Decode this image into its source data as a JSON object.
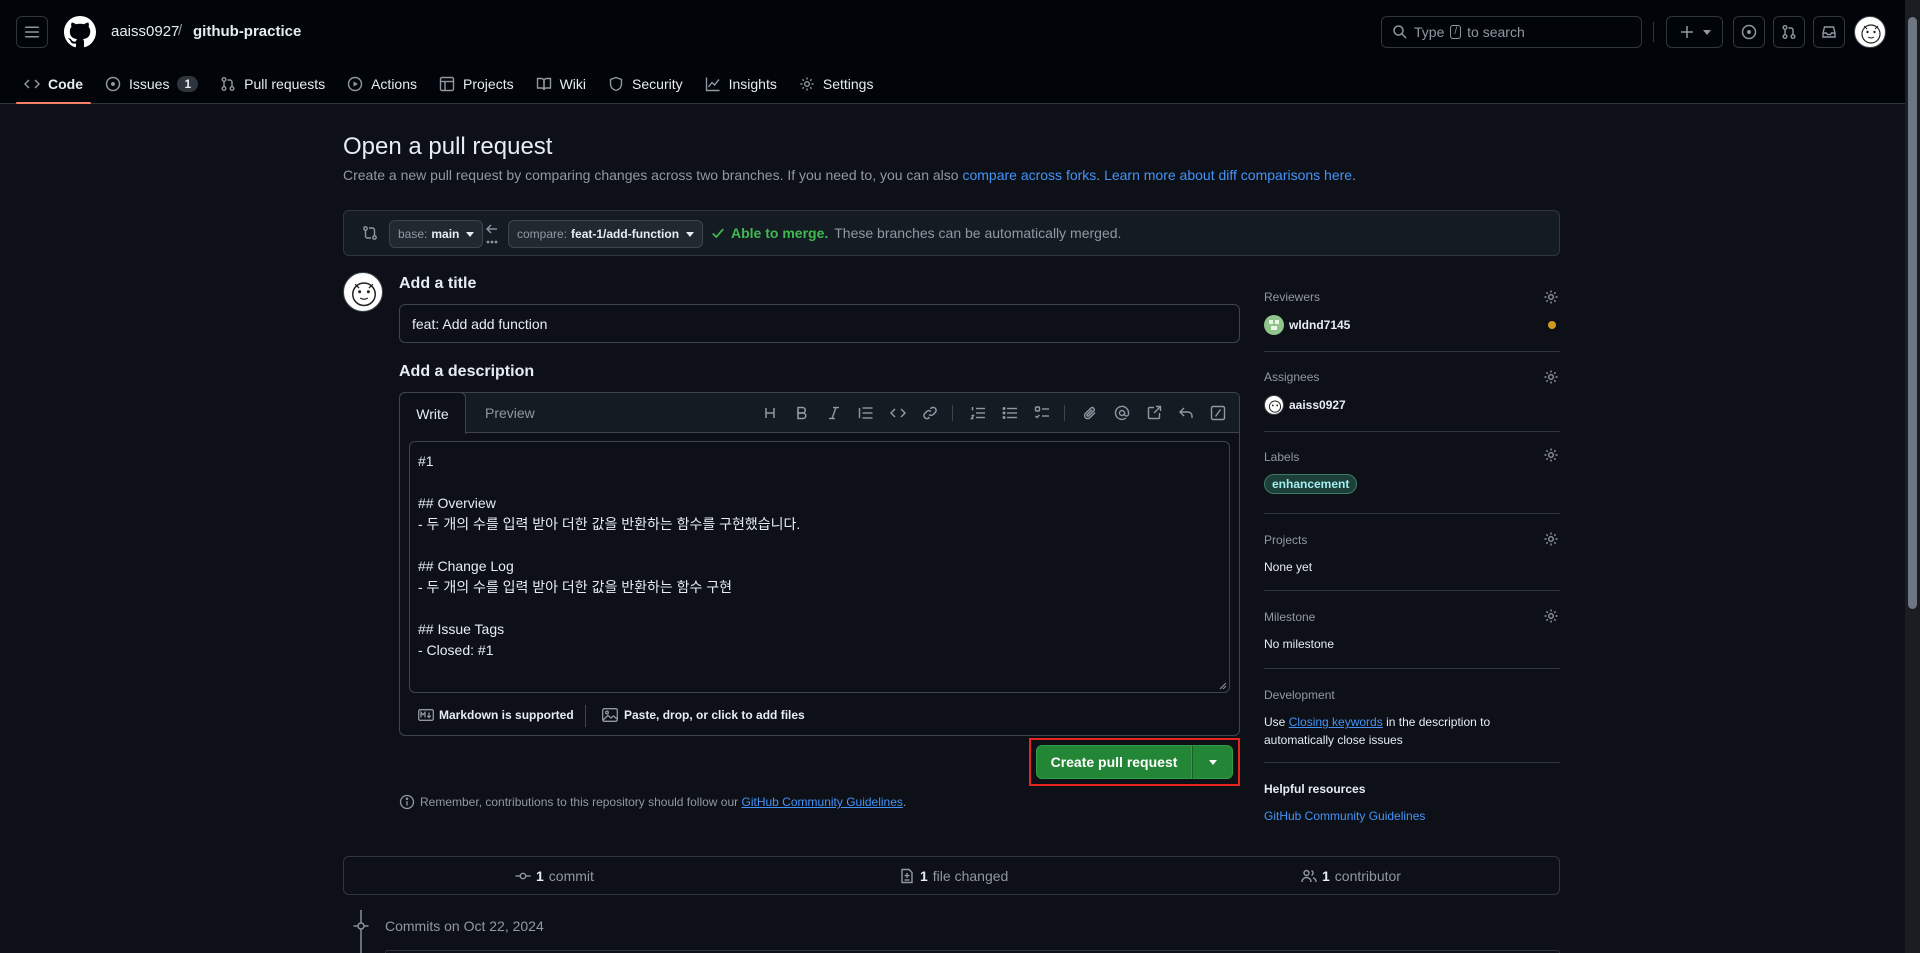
{
  "header": {
    "repo_owner": "aaiss0927",
    "repo_sep": "/",
    "repo_name": "github-practice",
    "search_type": "Type",
    "search_key": "/",
    "search_rest": "to search"
  },
  "tabs": [
    {
      "label": "Code",
      "icon": "code-icon"
    },
    {
      "label": "Issues",
      "icon": "issue-icon",
      "count": "1"
    },
    {
      "label": "Pull requests",
      "icon": "pull-request-icon"
    },
    {
      "label": "Actions",
      "icon": "play-icon"
    },
    {
      "label": "Projects",
      "icon": "table-icon"
    },
    {
      "label": "Wiki",
      "icon": "book-icon"
    },
    {
      "label": "Security",
      "icon": "shield-icon"
    },
    {
      "label": "Insights",
      "icon": "graph-icon"
    },
    {
      "label": "Settings",
      "icon": "gear-icon"
    }
  ],
  "main": {
    "title": "Open a pull request",
    "subtitle_prefix": "Create a new pull request by comparing changes across two branches. If you need to, you can also ",
    "subtitle_link1": "compare across forks",
    "subtitle_mid": ". ",
    "subtitle_link2": "Learn more about diff comparisons here",
    "subtitle_end": "."
  },
  "compare": {
    "base_prefix": "base:",
    "base_branch": "main",
    "compare_prefix": "compare:",
    "compare_branch": "feat-1/add-function",
    "merge_status": "Able to merge.",
    "merge_detail": "These branches can be automatically merged."
  },
  "form": {
    "title_heading": "Add a title",
    "title_value": "feat: Add add function",
    "desc_heading": "Add a description",
    "tab_write": "Write",
    "tab_preview": "Preview",
    "body_lines": [
      "#1",
      "",
      "## Overview",
      "- 두 개의 수를 입력 받아 더한 값을 반환하는 함수를 구현했습니다.",
      "",
      "## Change Log",
      "- 두 개의 수를 입력 받아 더한 값을 반환하는 함수 구현",
      "",
      "## Issue Tags",
      "- Closed: #1"
    ],
    "markdown_note": "Markdown is supported",
    "attach_note": "Paste, drop, or click to add files",
    "create_label": "Create pull request",
    "remember_prefix": "Remember, contributions to this repository should follow our ",
    "remember_link": "GitHub Community Guidelines",
    "remember_end": "."
  },
  "sidebar": {
    "reviewers_h": "Reviewers",
    "reviewer": "wldnd7145",
    "reviewer_status_color": "#d29922",
    "assignees_h": "Assignees",
    "assignee": "aaiss0927",
    "labels_h": "Labels",
    "label": "enhancement",
    "projects_h": "Projects",
    "projects_val": "None yet",
    "milestone_h": "Milestone",
    "milestone_val": "No milestone",
    "development_h": "Development",
    "dev_prefix": "Use ",
    "dev_link": "Closing keywords",
    "dev_rest1": " in the description to",
    "dev_rest2": "automatically close issues",
    "helpful_h": "Helpful resources",
    "helpful_link": "GitHub Community Guidelines"
  },
  "stats": {
    "commits_n": "1",
    "commits_label": "commit",
    "files_n": "1",
    "files_label": "file changed",
    "contrib_n": "1",
    "contrib_label": "contributor",
    "commits_on": "Commits on Oct 22, 2024"
  },
  "colors": {
    "accent_green": "#238636",
    "link_blue": "#4493f8",
    "highlight_red": "#e5241f",
    "merge_green": "#3fb950"
  }
}
